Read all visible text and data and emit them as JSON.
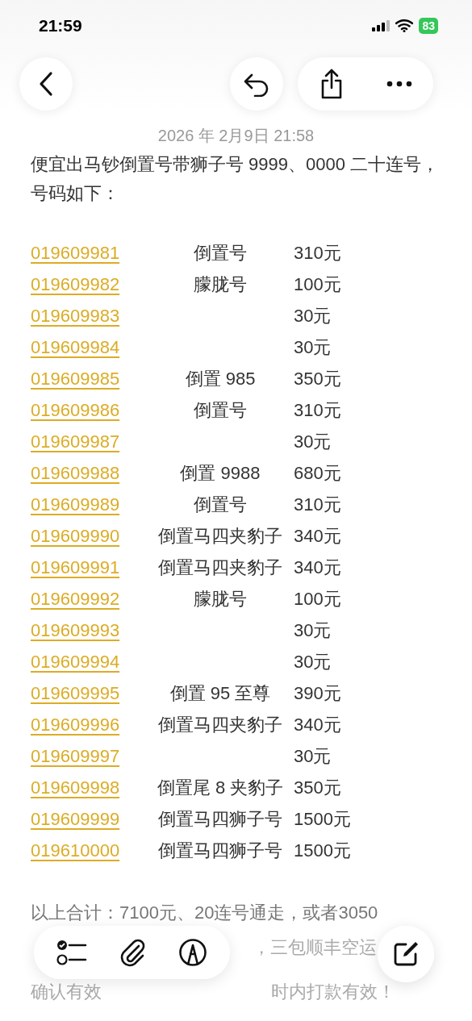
{
  "status_bar": {
    "time": "21:59",
    "battery": "83"
  },
  "note": {
    "date": "2026 年 2月9日 21:58",
    "intro": "便宜出马钞倒置号带狮子号 9999、0000 二十连号，号码如下：",
    "rows": [
      {
        "number": "019609981",
        "description": "倒置号",
        "price": "310元"
      },
      {
        "number": "019609982",
        "description": "朦胧号",
        "price": "100元"
      },
      {
        "number": "019609983",
        "price": "30元"
      },
      {
        "number": "019609984",
        "price": "30元"
      },
      {
        "number": "019609985",
        "description": "倒置 985",
        "price": "350元"
      },
      {
        "number": "019609986",
        "description": "倒置号",
        "price": "310元"
      },
      {
        "number": "019609987",
        "price": "30元"
      },
      {
        "number": "019609988",
        "description": "倒置 9988",
        "price": "680元"
      },
      {
        "number": "019609989",
        "description": "倒置号",
        "price": "310元"
      },
      {
        "number": "019609990",
        "description": "倒置马四夹豹子",
        "price": "340元"
      },
      {
        "number": "019609991",
        "description": "倒置马四夹豹子",
        "price": "340元"
      },
      {
        "number": "019609992",
        "description": "朦胧号",
        "price": "100元"
      },
      {
        "number": "019609993",
        "price": "30元"
      },
      {
        "number": "019609994",
        "price": "30元"
      },
      {
        "number": "019609995",
        "description": "倒置 95 至尊",
        "price": "390元"
      },
      {
        "number": "019609996",
        "description": "倒置马四夹豹子",
        "price": "340元"
      },
      {
        "number": "019609997",
        "price": "30元"
      },
      {
        "number": "019609998",
        "description": "倒置尾 8 夹豹子",
        "price": "350元"
      },
      {
        "number": "019609999",
        "description": "倒置马四狮子号",
        "price": "1500元"
      },
      {
        "number": "019610000",
        "description": "倒置马四狮子号",
        "price": "1500元"
      }
    ],
    "footer": [
      {
        "segments": [
          "以上合计：7100元、20连号通走，或者3050"
        ]
      },
      {
        "segments": [
          "，三包顺丰空运"
        ]
      },
      {
        "segments": [
          "确认有效",
          "时内打款有效！"
        ]
      }
    ]
  }
}
